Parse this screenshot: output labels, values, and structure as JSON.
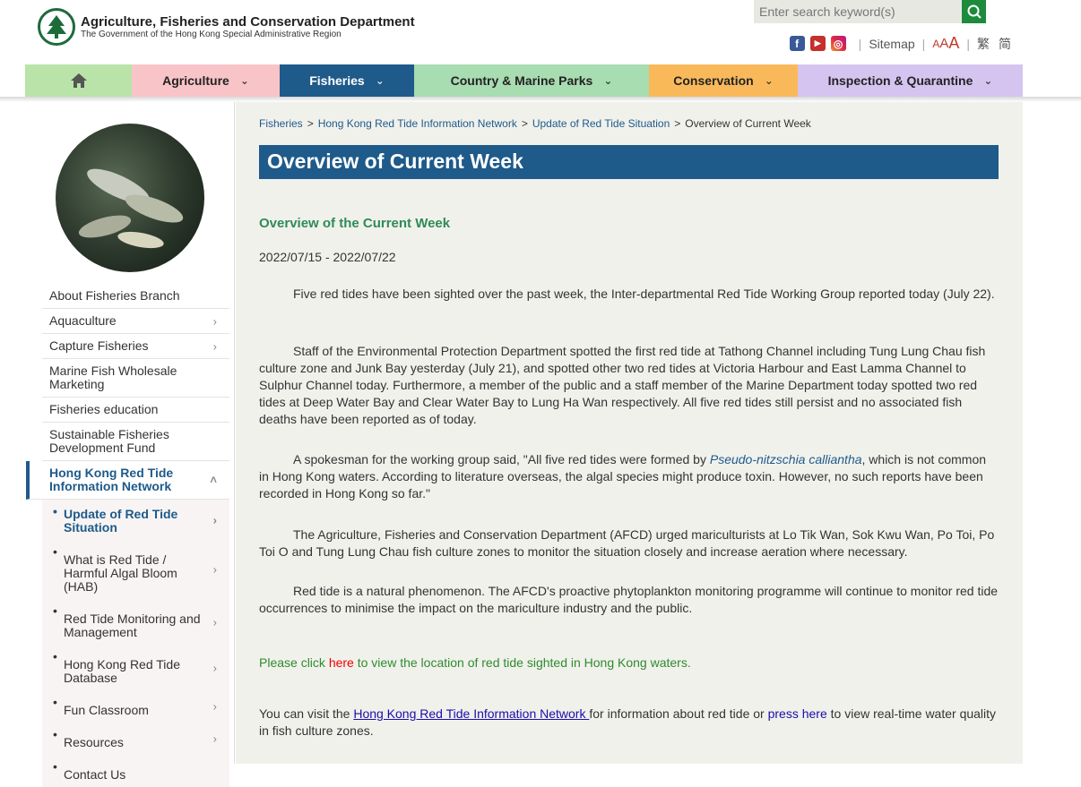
{
  "header": {
    "dept_name": "Agriculture, Fisheries and Conservation Department",
    "dept_sub": "The Government of the Hong Kong Special Administrative Region",
    "search_placeholder": "Enter search keyword(s)",
    "sitemap": "Sitemap",
    "font_small": "A",
    "font_mid": "A",
    "font_large": "A",
    "lang_trad": "繁",
    "lang_simp": "简"
  },
  "nav": {
    "items": [
      {
        "label": "",
        "color": "#b9e3a8"
      },
      {
        "label": "Agriculture",
        "color": "#f9c4c8"
      },
      {
        "label": "Fisheries",
        "color": "#1e5a8a"
      },
      {
        "label": "Country & Marine Parks",
        "color": "#a8dcb1"
      },
      {
        "label": "Conservation",
        "color": "#f9b95a"
      },
      {
        "label": "Inspection & Quarantine",
        "color": "#d6c4f0"
      }
    ]
  },
  "breadcrumb": {
    "items": [
      "Fisheries",
      "Hong Kong Red Tide Information Network",
      "Update of Red Tide Situation",
      "Overview of Current Week"
    ]
  },
  "sidebar": {
    "items": [
      {
        "label": "About Fisheries Branch"
      },
      {
        "label": "Aquaculture"
      },
      {
        "label": "Capture Fisheries"
      },
      {
        "label": "Marine Fish Wholesale Marketing"
      },
      {
        "label": "Fisheries education"
      },
      {
        "label": "Sustainable Fisheries Development Fund"
      },
      {
        "label": "Hong Kong Red Tide Information Network"
      }
    ],
    "subitems": [
      {
        "label": "Update of Red Tide Situation"
      },
      {
        "label": "What is Red Tide / Harmful Algal Bloom (HAB)"
      },
      {
        "label": "Red Tide Monitoring and Management"
      },
      {
        "label": "Hong Kong Red Tide Database"
      },
      {
        "label": "Fun Classroom"
      },
      {
        "label": "Resources"
      },
      {
        "label": "Contact Us"
      }
    ]
  },
  "main": {
    "title": "Overview of Current Week",
    "sub_heading": "Overview of the Current Week",
    "date_range": "2022/07/15 - 2022/07/22",
    "p1": "Five red tides have been sighted over the past week, the Inter-departmental Red Tide Working Group reported today (July 22).",
    "p2": "Staff of the Environmental Protection Department spotted the first red tide at Tathong Channel including Tung Lung Chau fish culture zone and Junk Bay yesterday (July 21), and spotted other two red tides at Victoria Harbour and East Lamma Channel to Sulphur Channel today. Furthermore, a member of the public and a staff member of the Marine Department today spotted two red tides at Deep Water Bay and Clear Water Bay to Lung Ha Wan respectively. All five red tides still persist and no associated fish deaths have been reported as of today.",
    "p3_a": "A spokesman for the working group said, \"All five red tides were formed by ",
    "p3_species": "Pseudo-nitzschia calliantha",
    "p3_b": ", which is not common in Hong Kong waters. According to literature overseas, the algal species might produce toxin. However, no such reports have been recorded in Hong Kong so far.\"",
    "p4": "The Agriculture, Fisheries and Conservation Department (AFCD) urged mariculturists at Lo Tik Wan, Sok Kwu Wan, Po Toi, Po Toi O and Tung Lung Chau fish culture zones to monitor the situation closely and increase aeration where necessary.",
    "p5": "Red tide is a natural phenomenon. The AFCD's proactive phytoplankton monitoring programme will continue to monitor red tide occurrences to minimise the impact on the mariculture industry and the public.",
    "click_a": "Please click ",
    "click_here": "here",
    "click_b": " to view the location of red tide sighted in Hong Kong waters.",
    "visit_a": "You can visit the ",
    "visit_link": "Hong Kong Red Tide Information Network ",
    "visit_b": "for information about red tide or ",
    "visit_press": "press here",
    "visit_c": " to view real-time water quality in fish culture zones."
  }
}
